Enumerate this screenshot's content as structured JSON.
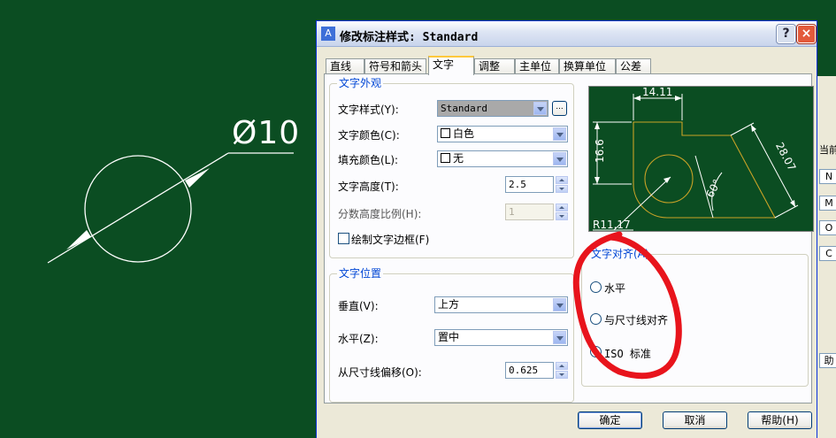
{
  "cad": {
    "dimension_text": "Ø10"
  },
  "dialog": {
    "title": "修改标注样式: Standard",
    "help_label": "?",
    "close_label": "×"
  },
  "tabs": [
    "直线",
    "符号和箭头",
    "文字",
    "调整",
    "主单位",
    "换算单位",
    "公差"
  ],
  "active_tab": "文字",
  "text_appearance": {
    "title": "文字外观",
    "style_label": "文字样式(Y):",
    "style_value": "Standard",
    "browse_label": "...",
    "color_label": "文字颜色(C):",
    "color_value": "白色",
    "fill_label": "填充颜色(L):",
    "fill_value": "无",
    "height_label": "文字高度(T):",
    "height_value": "2.5",
    "fraction_label": "分数高度比例(H):",
    "fraction_value": "1",
    "frame_label": "绘制文字边框(F)"
  },
  "text_position": {
    "title": "文字位置",
    "vertical_label": "垂直(V):",
    "vertical_value": "上方",
    "horizontal_label": "水平(Z):",
    "horizontal_value": "置中",
    "offset_label": "从尺寸线偏移(O):",
    "offset_value": "0.625"
  },
  "preview": {
    "dim_top": "14.11",
    "dim_left": "16.6",
    "dim_right": "28.07",
    "dim_angle": "60°",
    "dim_radius": "R11.17"
  },
  "text_alignment": {
    "title": "文字对齐(A)",
    "options": [
      "水平",
      "与尺寸线对齐",
      "ISO 标准"
    ],
    "selected": "ISO 标准"
  },
  "buttons": {
    "ok": "确定",
    "cancel": "取消",
    "help": "帮助(H)"
  },
  "background_panel": {
    "label": "当前",
    "items": [
      "N",
      "M",
      "O",
      "C"
    ],
    "bottom": "助"
  },
  "colors": {
    "model_background": "#0b4d22",
    "annotation": "#e8141c",
    "tab_highlight": "#ffc83c",
    "group_title": "#0046d5"
  }
}
